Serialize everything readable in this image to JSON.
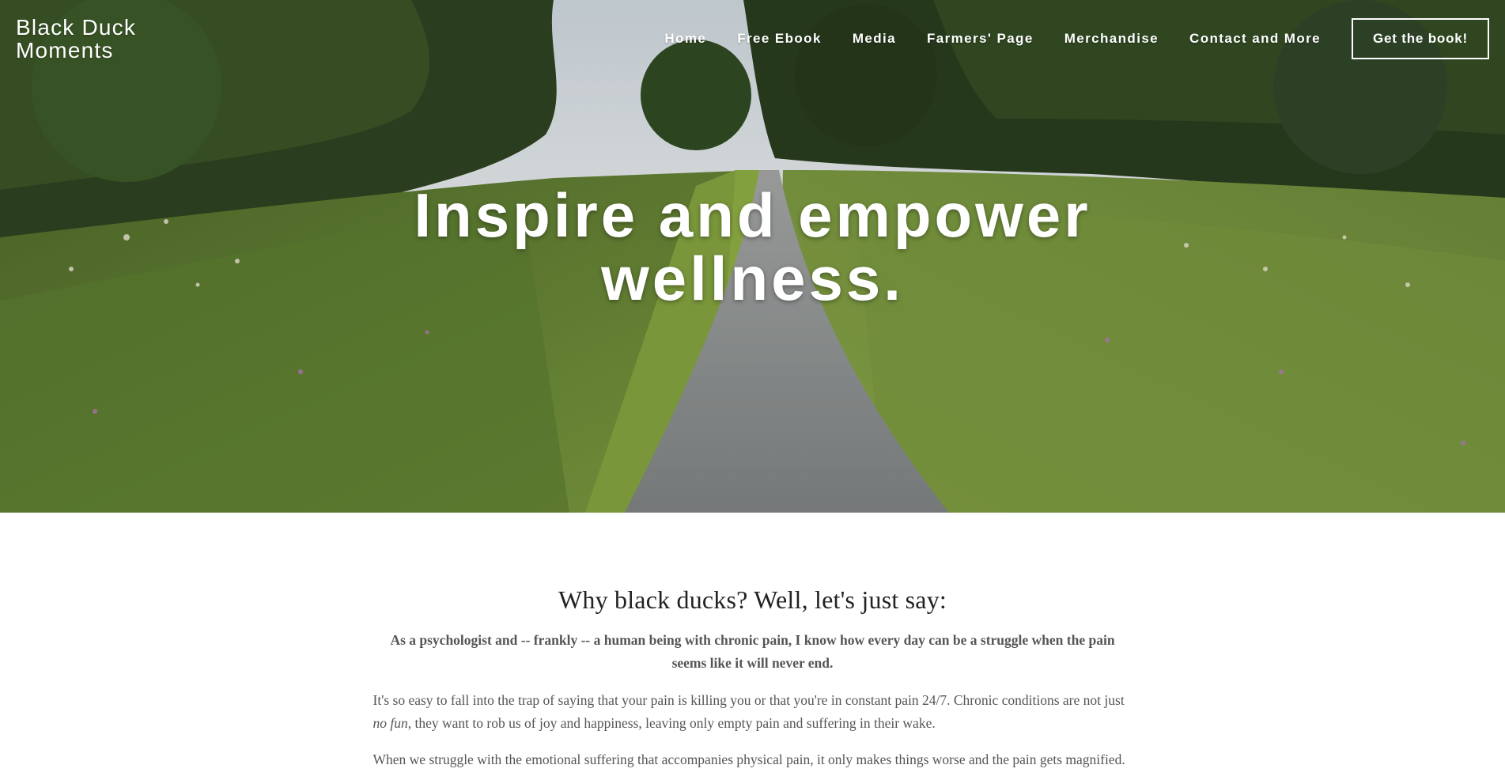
{
  "brand": {
    "line1": "Black Duck",
    "line2": "Moments"
  },
  "nav": {
    "items": [
      "Home",
      "Free Ebook",
      "Media",
      "Farmers' Page",
      "Merchandise",
      "Contact and More"
    ],
    "cta": "Get the book!"
  },
  "hero": {
    "line1": "Inspire and empower",
    "line2": "wellness."
  },
  "section": {
    "heading": "Why black ducks? Well, let's just say:",
    "lead": "As a psychologist and -- frankly -- a human being with chronic pain, I know how every day can be a struggle when the pain seems like it will never end.",
    "p1_start": "It's so easy to fall into the trap of saying that your pain is killing you or that you're in constant pain 24/7. Chronic conditions are not just ",
    "p1_em": "no fun",
    "p1_end": ", they want to rob us of joy and happiness, leaving only empty pain and suffering in their wake.",
    "p2": "When we struggle with the emotional suffering that accompanies physical pain, it only makes things worse and the pain gets magnified."
  },
  "colors": {
    "text": "#555555",
    "heading": "#222222",
    "grass": "#6f8a3b",
    "trees": "#2f4322",
    "path": "#8a8d8e"
  }
}
